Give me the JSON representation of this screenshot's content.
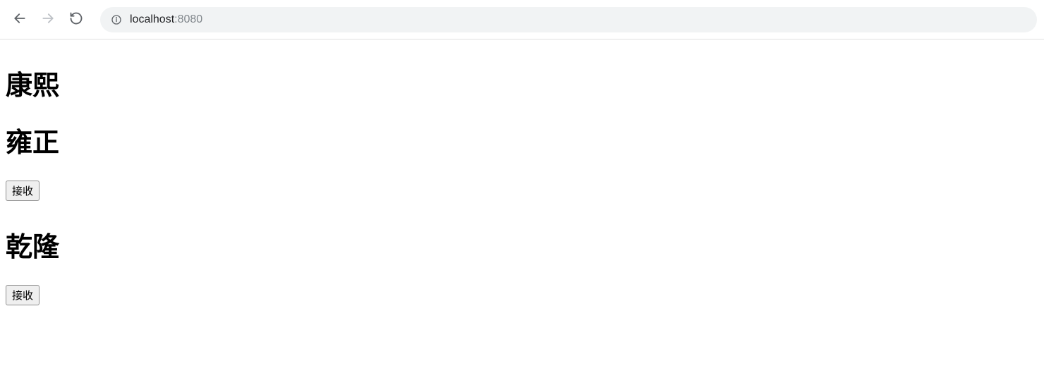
{
  "browser": {
    "url_host": "localhost",
    "url_port": ":8080"
  },
  "page": {
    "headings": [
      {
        "text": "康熙"
      },
      {
        "text": "雍正"
      },
      {
        "text": "乾隆"
      }
    ],
    "button_label": "接收"
  }
}
